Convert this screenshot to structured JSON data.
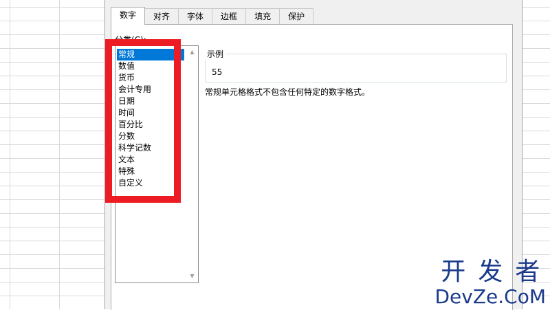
{
  "dialog": {
    "tabs": [
      {
        "label": "数字",
        "active": true
      },
      {
        "label": "对齐",
        "active": false
      },
      {
        "label": "字体",
        "active": false
      },
      {
        "label": "边框",
        "active": false
      },
      {
        "label": "填充",
        "active": false
      },
      {
        "label": "保护",
        "active": false
      }
    ],
    "category_label": "分类(C):",
    "categories": [
      {
        "label": "常规",
        "selected": true
      },
      {
        "label": "数值"
      },
      {
        "label": "货币"
      },
      {
        "label": "会计专用"
      },
      {
        "label": "日期"
      },
      {
        "label": "时间"
      },
      {
        "label": "百分比"
      },
      {
        "label": "分数"
      },
      {
        "label": "科学记数"
      },
      {
        "label": "文本"
      },
      {
        "label": "特殊"
      },
      {
        "label": "自定义"
      }
    ],
    "sample": {
      "title": "示例",
      "value": "55"
    },
    "description": "常规单元格格式不包含任何特定的数字格式。"
  },
  "watermark": {
    "line1": "开发者",
    "line2": "DevZe.CoM"
  },
  "colors": {
    "selection": "#0078d7",
    "highlight_border": "#ed1c24",
    "watermark": "#1a3a8c",
    "dialog_bg": "#f0f0f0"
  },
  "icons": {
    "scroll_up": "triangle-up-icon",
    "scroll_down": "triangle-down-icon"
  }
}
